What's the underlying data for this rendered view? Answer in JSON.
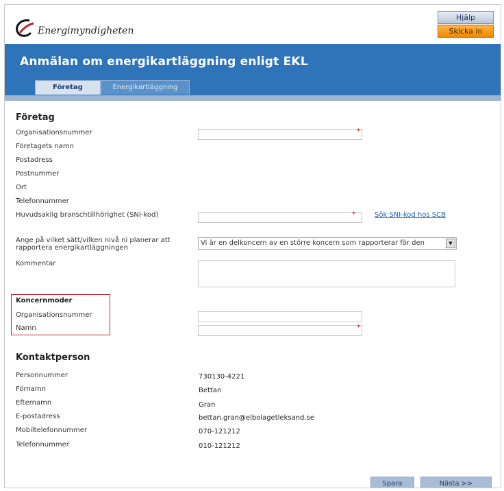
{
  "header": {
    "logo_text": "Energimyndigheten",
    "help_label": "Hjälp",
    "send_label": "Skicka in"
  },
  "banner": {
    "title": "Anmälan om energikartläggning enligt EKL",
    "tabs": [
      {
        "label": "Företag",
        "active": true
      },
      {
        "label": "Energikartläggning",
        "active": false
      }
    ]
  },
  "company": {
    "title": "Företag",
    "org_label": "Organisationsnummer",
    "name_label": "Företagets namn",
    "address_label": "Postadress",
    "postal_label": "Postnummer",
    "city_label": "Ort",
    "phone_label": "Telefonnummer",
    "sni_label": "Huvudsaklig branschtillhörighet (SNI-kod)",
    "sni_link": "Sök SNI-kod hos SCB",
    "report_level_label": "Ange på vilket sätt/vilken nivå ni planerar att rapportera energikartläggningen",
    "report_level_value": "Vi är en delkoncern av en större koncern som rapporterar för den",
    "comment_label": "Kommentar",
    "required_mark": "*"
  },
  "parent": {
    "title": "Koncernmoder",
    "org_label": "Organisationsnummer",
    "name_label": "Namn"
  },
  "contact": {
    "title": "Kontaktperson",
    "fields": [
      {
        "label": "Personnummer",
        "value": "730130-4221"
      },
      {
        "label": "Förnamn",
        "value": "Bettan"
      },
      {
        "label": "Efternamn",
        "value": "Gran"
      },
      {
        "label": "E-postadress",
        "value": "bettan.gran@elbolagetleksand.se"
      },
      {
        "label": "Mobiltelefonnummer",
        "value": "070-121212"
      },
      {
        "label": "Telefonnummer",
        "value": "010-121212"
      }
    ]
  },
  "footer": {
    "save_label": "Spara",
    "next_label": "Nästa >>"
  },
  "colors": {
    "banner": "#2f73b8",
    "send_button": "#f08a00",
    "highlight": "#c0272d",
    "required": "#d0212d"
  }
}
